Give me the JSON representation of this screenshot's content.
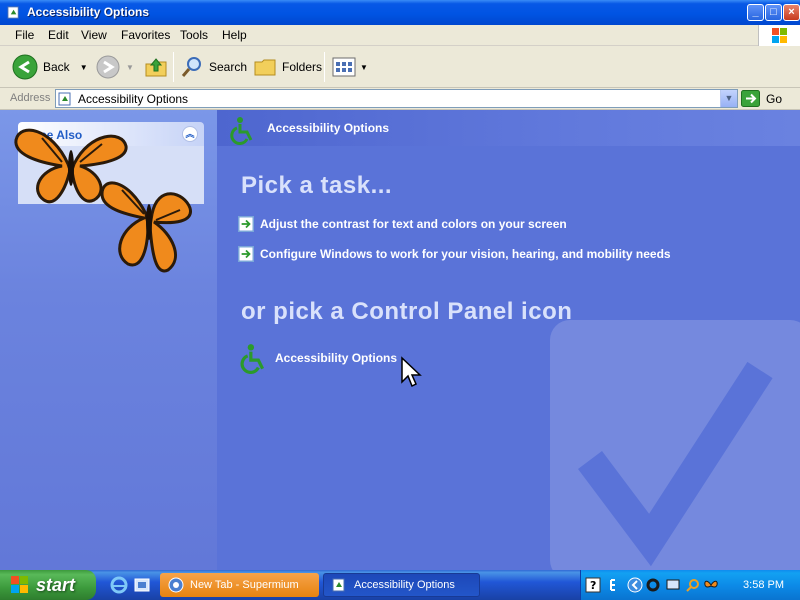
{
  "window": {
    "title": "Accessibility Options"
  },
  "menu": [
    "File",
    "Edit",
    "View",
    "Favorites",
    "Tools",
    "Help"
  ],
  "toolbar": {
    "back_label": "Back",
    "search_label": "Search",
    "folders_label": "Folders"
  },
  "address": {
    "label": "Address",
    "value": "Accessibility Options",
    "go_label": "Go"
  },
  "sidebar": {
    "see_also_title": "See Also"
  },
  "main": {
    "header_title": "Accessibility Options",
    "pick_task": "Pick a task...",
    "tasks": [
      "Adjust the contrast for text and colors on your screen",
      "Configure Windows to work for your vision, hearing, and mobility needs"
    ],
    "pick_icon": "or pick a Control Panel icon",
    "cp_icon_label": "Accessibility Options"
  },
  "taskbar": {
    "start_label": "start",
    "buttons": [
      "New Tab - Supermium",
      "Accessibility Options"
    ],
    "clock": "3:58 PM"
  },
  "colors": {
    "titlebar": "#0054e3",
    "content_bg": "#5a73d8",
    "start_green": "#3c9a3c"
  }
}
